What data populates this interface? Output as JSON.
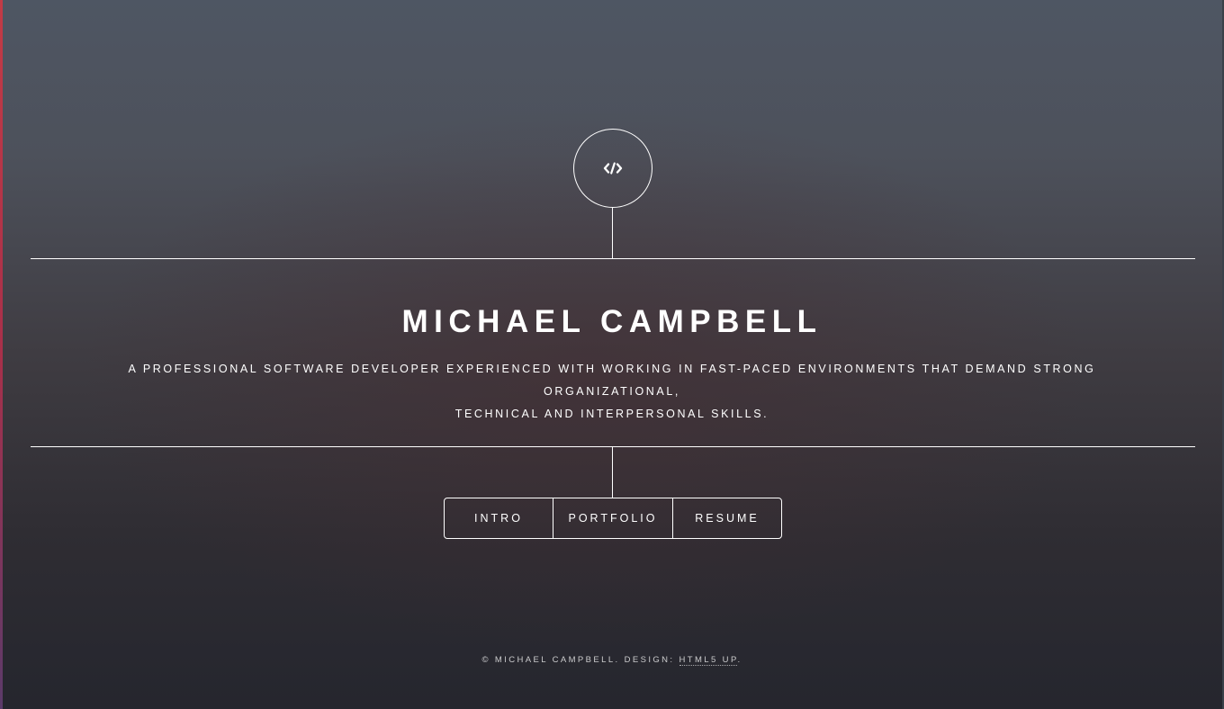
{
  "header": {
    "logo_icon": "code-icon"
  },
  "main": {
    "title": "MICHAEL CAMPBELL",
    "subtitle_line1": "A PROFESSIONAL SOFTWARE DEVELOPER EXPERIENCED WITH WORKING IN FAST-PACED ENVIRONMENTS THAT DEMAND STRONG ORGANIZATIONAL,",
    "subtitle_line2": "TECHNICAL AND INTERPERSONAL SKILLS."
  },
  "nav": {
    "items": [
      {
        "label": "INTRO"
      },
      {
        "label": "PORTFOLIO"
      },
      {
        "label": "RESUME"
      }
    ]
  },
  "footer": {
    "copyright": "© MICHAEL CAMPBELL. DESIGN: ",
    "design_link": "HTML5 UP",
    "suffix": "."
  },
  "colors": {
    "foreground": "#ffffff",
    "accent_edge": "#c23b46"
  }
}
